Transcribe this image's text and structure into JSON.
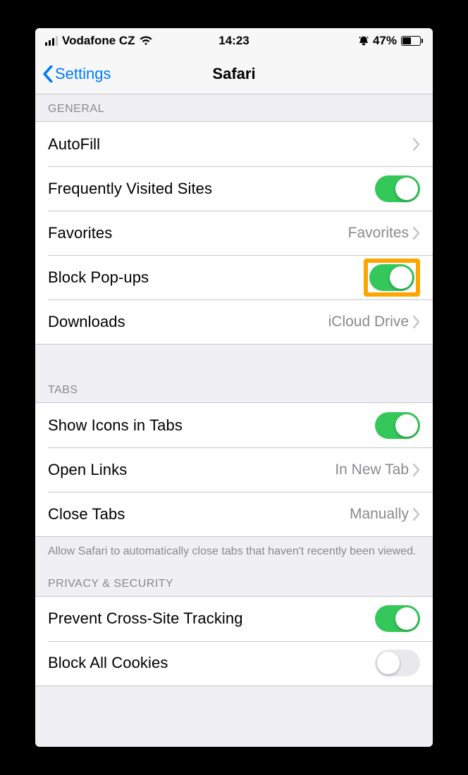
{
  "status": {
    "carrier": "Vodafone CZ",
    "time": "14:23",
    "battery_pct": "47%"
  },
  "nav": {
    "back_label": "Settings",
    "title": "Safari"
  },
  "sections": {
    "general": {
      "header": "General",
      "autofill": "AutoFill",
      "frequently_visited": "Frequently Visited Sites",
      "favorites_label": "Favorites",
      "favorites_value": "Favorites",
      "block_popups": "Block Pop-ups",
      "downloads_label": "Downloads",
      "downloads_value": "iCloud Drive"
    },
    "tabs": {
      "header": "Tabs",
      "show_icons": "Show Icons in Tabs",
      "open_links_label": "Open Links",
      "open_links_value": "In New Tab",
      "close_tabs_label": "Close Tabs",
      "close_tabs_value": "Manually",
      "footer": "Allow Safari to automatically close tabs that haven't recently been viewed."
    },
    "privacy": {
      "header": "Privacy & Security",
      "prevent_cross_site": "Prevent Cross-Site Tracking",
      "block_cookies": "Block All Cookies"
    }
  }
}
